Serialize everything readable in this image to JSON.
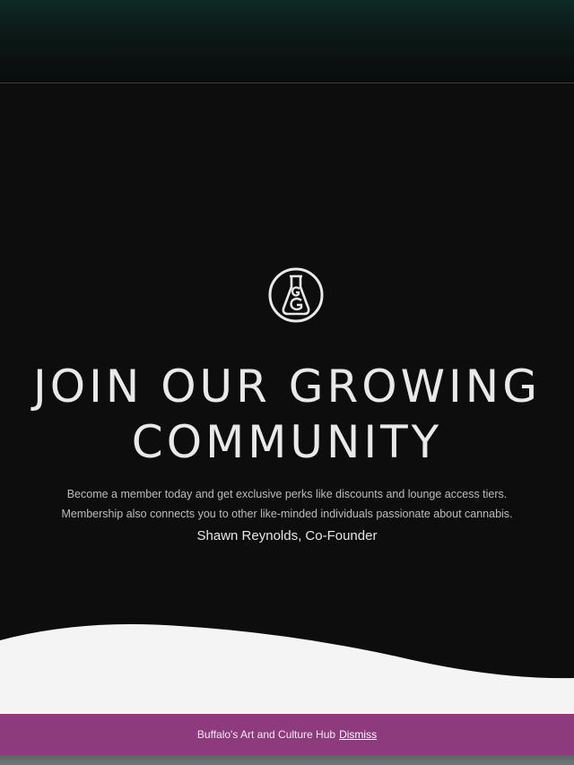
{
  "hero": {
    "logo_icon": "beaker-monogram-logo-icon",
    "logo_letters": "GG",
    "headline_line1": "JOIN OUR GROWING",
    "headline_line2": "COMMUNITY",
    "description_line1": "Become a member today and get exclusive perks like discounts and lounge access tiers.",
    "description_line2": "Membership also connects you to other like-minded individuals passionate about cannabis.",
    "author": "Shawn Reynolds, Co-Founder"
  },
  "banner": {
    "text": "Buffalo's Art and Culture Hub",
    "dismiss_label": "Dismiss",
    "background_color": "#8e3b7e"
  }
}
